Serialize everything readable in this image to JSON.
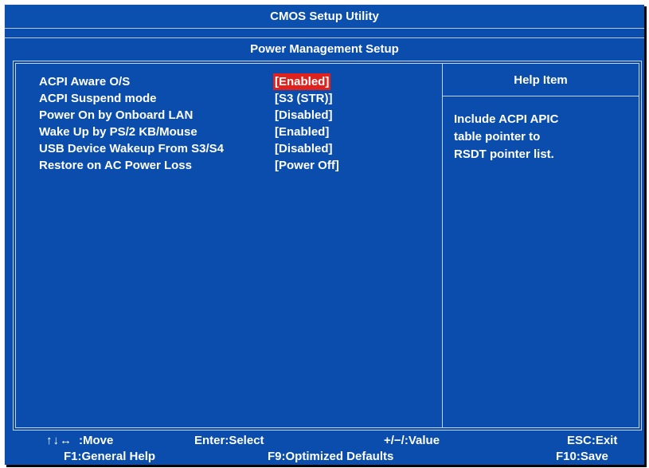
{
  "title": "CMOS Setup Utility",
  "subtitle": "Power Management Setup",
  "settings": [
    {
      "label": "ACPI Aware O/S",
      "value": "[Enabled]",
      "selected": true
    },
    {
      "label": "ACPI Suspend mode",
      "value": "[S3 (STR)]",
      "selected": false
    },
    {
      "label": "Power On by Onboard LAN",
      "value": "[Disabled]",
      "selected": false
    },
    {
      "label": "Wake Up by PS/2 KB/Mouse",
      "value": "[Enabled]",
      "selected": false
    },
    {
      "label": "USB Device Wakeup From S3/S4",
      "value": "[Disabled]",
      "selected": false
    },
    {
      "label": "Restore on AC Power Loss",
      "value": "[Power Off]",
      "selected": false
    }
  ],
  "help": {
    "title": "Help Item",
    "lines": [
      "Include ACPI APIC",
      "table pointer to",
      "RSDT pointer list."
    ]
  },
  "footer": {
    "move_keys": "↑↓↔",
    "move": ":Move",
    "select": "Enter:Select",
    "value": "+/−/:Value",
    "exit": "ESC:Exit",
    "general_help": "F1:General Help",
    "defaults": "F9:Optimized Defaults",
    "save": "F10:Save"
  },
  "colors": {
    "background": "#0a4dac",
    "highlight": "#e0211c",
    "text": "#ffffff"
  }
}
